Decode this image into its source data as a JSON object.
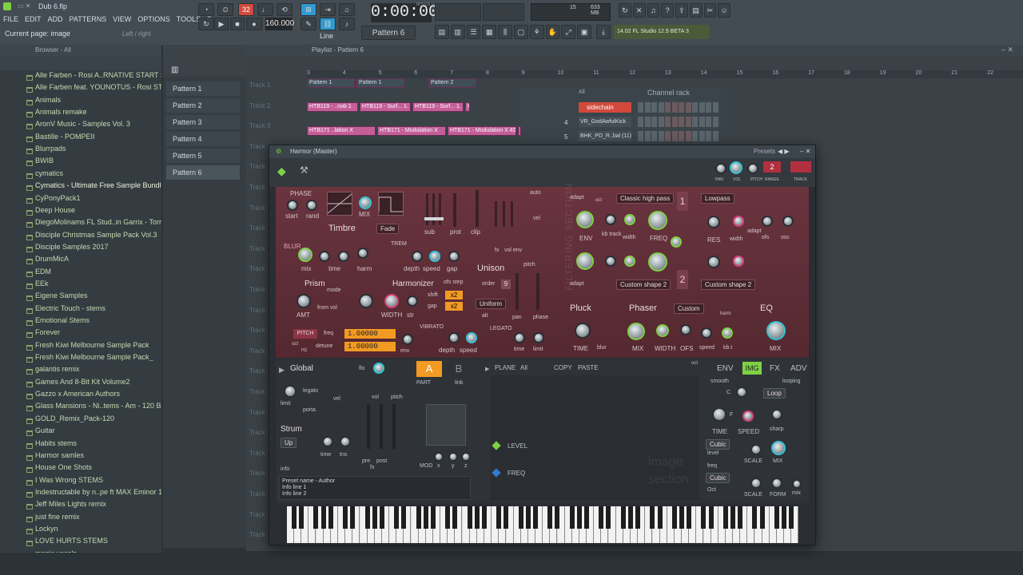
{
  "project": {
    "name": "Dub 6.flp"
  },
  "menu": [
    "FILE",
    "EDIT",
    "ADD",
    "PATTERNS",
    "VIEW",
    "OPTIONS",
    "TOOLS",
    "?"
  ],
  "hint": {
    "current_page": "Current page: image",
    "nav": "Left / right"
  },
  "transport": {
    "time": "0:00:00",
    "tempo": "160.000",
    "pattern": "Pattern 6",
    "mode": "Line",
    "memory": "633 MB",
    "cpu": "15",
    "msc": "M:S:CS"
  },
  "app": {
    "version": "14.02  FL Studio 12.9 BETA 3"
  },
  "browser": {
    "title": "Browser - All",
    "items": [
      "Alle Farben - Rosi A..RNATIVE START STEMS",
      "Alle Farben feat. YOUNOTUS - Rosi STEMS",
      "Animals",
      "Animals remake",
      "AronV Music - Samples Vol. 3",
      "Bastille - POMPEII",
      "Blurrpads",
      "BWIB",
      "cymatics",
      "Cymatics - Ultimate Free Sample Bundle",
      "CyPonyPack1",
      "Deep House",
      "DiegoMolinams FL Stud..in Garrix - Torrent",
      "Disciple Christmas Sample Pack Vol.3",
      "Disciple Samples 2017",
      "DrumMicA",
      "EDM",
      "EEk",
      "Eigene Samples",
      "Electric Touch - stems",
      "Emotional Stems",
      "Forever",
      "Fresh Kiwi Melbourne Sample Pack",
      "Fresh Kiwi Melbourne Sample Pack_",
      "galantis remix",
      "Games And 8-Bit Kit Volume2",
      "Gazzo x American Authors",
      "Glass Mansions - Ni..tems - Am - 120 BPM",
      "GOLD_Remix_Pack-120",
      "Guitar",
      "Habits stems",
      "Harmor samles",
      "House One Shots",
      "I Was Wrong STEMS",
      "Indestructable by n..pe ft MAX Eminor 160",
      "Jeff Miles Lights remix",
      "just fine remix",
      "Lockyn",
      "LOVE HURTS STEMS",
      "magic vocals"
    ]
  },
  "patterns": [
    "Pattern 1",
    "Pattern 2",
    "Pattern 3",
    "Pattern 4",
    "Pattern 5",
    "Pattern 6"
  ],
  "playlist": {
    "title": "Playlist - Pattern 6",
    "tracks": [
      "Track 1",
      "Track 2",
      "Track 3",
      "Track",
      "Track",
      "Track",
      "Track",
      "Track",
      "Track",
      "Track",
      "Track",
      "Track",
      "Track",
      "Track",
      "Track",
      "Track",
      "Track",
      "Track",
      "Track",
      "Track",
      "Track",
      "Track",
      "Track"
    ],
    "ruler": [
      "3",
      "4",
      "5",
      "6",
      "7",
      "8",
      "9",
      "10",
      "11",
      "12",
      "13",
      "14",
      "15",
      "16",
      "17",
      "18",
      "19",
      "20",
      "21",
      "22",
      "23"
    ],
    "pattern_clips": [
      "Pattern 1",
      "Pattern 1",
      "Pattern 2",
      "Pattern 1",
      "Pattern 1",
      "Pattern 1",
      "Pattern 2"
    ],
    "auto_clips_row2": [
      "HTB119 - ..nob 1",
      "HTB119 - Surf... 1. Knob 1",
      "HTB119 - Surf... 1. Knob 1",
      "HTB11"
    ],
    "auto_clips_row3": [
      "HTB171 ..lation X",
      "HTB171 - Modulation X",
      "HTB171 - Modulation X #2",
      "HTB1"
    ]
  },
  "channel_rack": {
    "title": "Channel rack",
    "filter": "All",
    "channels": [
      {
        "num": "",
        "name": "sidechain"
      },
      {
        "num": "4",
        "name": "VR_GodAwfulKick"
      },
      {
        "num": "5",
        "name": "BHK_PD_R..bal (11)"
      }
    ]
  },
  "harmor": {
    "title": "Harmor (Master)",
    "presets_label": "Presets",
    "head": {
      "pan": "PAN",
      "vol": "VOL",
      "pitch": "PITCH",
      "range": "RANGE",
      "range_value": "2",
      "track": "TRACK"
    },
    "timbre": {
      "phase": "PHASE",
      "start": "start",
      "rand": "rand",
      "mix": "MIX",
      "title": "Timbre",
      "fade": "Fade",
      "sub": "sub",
      "prot": "prot",
      "clip": "clip",
      "auto": "auto",
      "vel": "vel",
      "fx": "fx",
      "vol_env": "vol env",
      "pitch": "pitch"
    },
    "blur": {
      "title": "BLUR",
      "mix": "mix",
      "time": "time",
      "harm": "harm",
      "trem": "TREM",
      "depth": "depth",
      "speed": "speed",
      "gap": "gap"
    },
    "prism": {
      "title": "Prism",
      "mode": "mode",
      "amt": "AMT",
      "from_vol": "from vol",
      "harmonizer": "Harmonizer",
      "width": "WIDTH",
      "str": "str",
      "ofs_step": "ofs step",
      "shift": "shift",
      "gap": "gap",
      "shift_val": "x2",
      "gap_val": "x2"
    },
    "pitch": {
      "label": "PITCH",
      "freq": "freq",
      "detune": "detune",
      "oct": "oct",
      "hz": "Hz",
      "env": "env",
      "freq_val": "1.00000",
      "detune_val": "1.00000",
      "vibrato": "VIBRATO",
      "depth": "depth",
      "speed": "speed"
    },
    "unison": {
      "title": "Unison",
      "order": "order",
      "order_val": "9",
      "mode": "Uniform",
      "alt": "alt",
      "pan": "pan",
      "phase": "phase",
      "legato": "LEGATO",
      "time": "time",
      "limit": "limit"
    },
    "filters": {
      "adapt": "adapt",
      "type1": "Classic high pass",
      "type2": "Custom shape 2",
      "oct": "oct",
      "hz": "Hz",
      "vel": "vel",
      "env": "ENV",
      "kb_track": "kb track",
      "width": "width",
      "freq": "FREQ",
      "num1": "1",
      "num2": "2",
      "section": "FILTERING SECTION"
    },
    "filter2": {
      "type1": "Lowpass",
      "type2": "Custom shape 2",
      "res": "RES",
      "width": "width",
      "adapt": "adapt",
      "ofs": "ofs",
      "osc": "osc",
      "oct": "oct",
      "hz": "Hz",
      "vel": "vel"
    },
    "pluck": {
      "title": "Pluck",
      "time": "TIME",
      "blur": "blur"
    },
    "phaser": {
      "title": "Phaser",
      "mode": "Custom",
      "mix": "MIX",
      "width": "WIDTH",
      "ofs": "OFS",
      "speed": "speed",
      "kbt": "kb.t",
      "oct": "oct",
      "hz": "Hz",
      "harm": "harm"
    },
    "eq": {
      "title": "EQ",
      "mix": "MIX"
    },
    "global": {
      "title": "Global",
      "lfo": "lfo",
      "legato": "legato",
      "vel": "vel",
      "limit": "limit",
      "porta": "porta",
      "part": "PART",
      "link": "link",
      "a": "A",
      "b": "B",
      "vol": "vol",
      "pitch": "pitch",
      "strum": "Strum",
      "strum_mode": "Up",
      "time": "time",
      "tns": "tns",
      "pre": "pre",
      "post": "post",
      "fx": "fx",
      "mod": "MOD",
      "x": "x",
      "y": "y",
      "z": "z",
      "info": "info",
      "preset_name": "Preset name - Author",
      "info1": "Info line 1",
      "info2": "Info line 2"
    },
    "image": {
      "plane": "PLANE",
      "plane_all": "All",
      "copy": "COPY",
      "paste": "PASTE",
      "level": "LEVEL",
      "freq": "FREQ",
      "watermark": "image section",
      "oct": "oct",
      "hz": "Hz"
    },
    "tabs": {
      "env": "ENV",
      "img": "IMG",
      "fx": "FX",
      "adv": "ADV"
    },
    "img_panel": {
      "smooth": "smooth",
      "c": "C",
      "f": "F",
      "loop": "Loop",
      "looping": "looping",
      "time": "TIME",
      "speed": "SPEED",
      "sharp": "sharp",
      "cubic1": "Cubic",
      "level": "level",
      "scale": "SCALE",
      "mix": "MIX",
      "freq": "freq",
      "cubic2": "Cubic",
      "oct": "Oct",
      "scale2": "SCALE",
      "form": "FORM",
      "mix2": "mix"
    }
  },
  "colors": {
    "accent_green": "#7fd144",
    "teal": "#35c3d6",
    "pink": "#d8427a",
    "orange": "#f29a22",
    "red_panel": "#5c2d36"
  }
}
